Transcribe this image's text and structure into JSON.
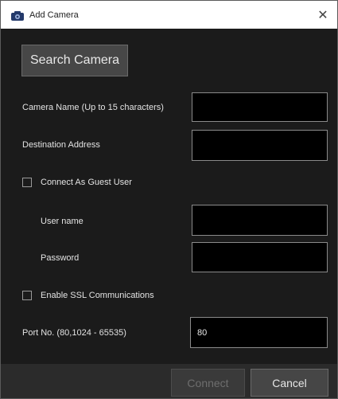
{
  "window": {
    "title": "Add Camera",
    "close_glyph": "✕"
  },
  "search_button": {
    "label": "Search Camera"
  },
  "fields": {
    "camera_name": {
      "label": "Camera Name  (Up to 15 characters)",
      "value": ""
    },
    "destination_address": {
      "label": "Destination Address",
      "value": ""
    },
    "guest_user": {
      "label": "Connect As Guest User",
      "checked": false
    },
    "user_name": {
      "label": "User name",
      "value": ""
    },
    "password": {
      "label": "Password",
      "value": ""
    },
    "ssl": {
      "label": "Enable SSL Communications",
      "checked": false
    },
    "port": {
      "label": "Port No. (80,1024 - 65535)",
      "value": "80"
    }
  },
  "footer": {
    "connect_label": "Connect",
    "cancel_label": "Cancel"
  },
  "icons": {
    "app": "camera-app-icon",
    "close": "close-icon"
  },
  "colors": {
    "background": "#1b1b1b",
    "titlebar": "#ffffff",
    "footer": "#2b2b2b",
    "input_bg": "#000000",
    "text": "#e3e3e3",
    "disabled_text": "#6e6e6e"
  }
}
